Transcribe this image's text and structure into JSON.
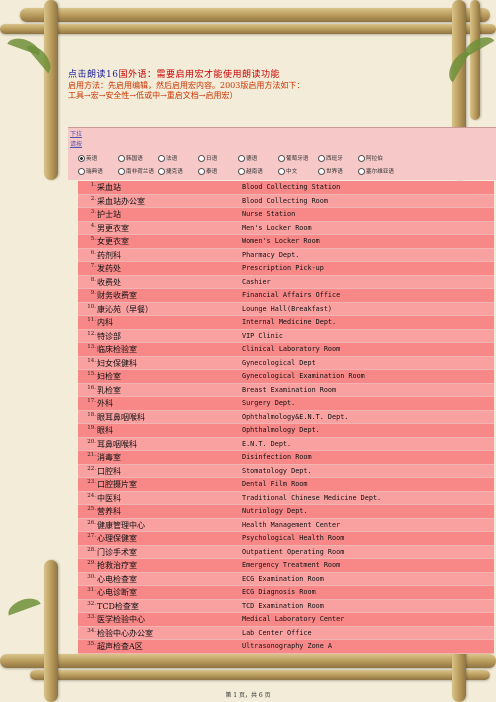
{
  "header": {
    "line1_prefix": "点击朗读",
    "line1_count": "16",
    "line1_suffix": "国外语：需要启用宏才能使用朗读功能",
    "line2": "启用方法：先启用编辑，然后启用宏内容。2003版启用方法如下：",
    "line3": "工具→宏→安全性→低或中→重启文档→启用宏）"
  },
  "panel": {
    "label1": "下拉",
    "label2": "请按",
    "row1": [
      {
        "label": "英语",
        "selected": true
      },
      {
        "label": "韩国语",
        "selected": false
      },
      {
        "label": "法语",
        "selected": false
      },
      {
        "label": "日语",
        "selected": false
      },
      {
        "label": "德语",
        "selected": false
      },
      {
        "label": "葡萄牙语",
        "selected": false
      },
      {
        "label": "西班牙",
        "selected": false
      },
      {
        "label": "阿拉伯",
        "selected": false
      }
    ],
    "row2": [
      {
        "label": "瑞典语",
        "selected": false
      },
      {
        "label": "南非荷兰语",
        "selected": false
      },
      {
        "label": "捷克语",
        "selected": false
      },
      {
        "label": "泰语",
        "selected": false
      },
      {
        "label": "越南语",
        "selected": false
      },
      {
        "label": "中文",
        "selected": false
      },
      {
        "label": "世界语",
        "selected": false
      },
      {
        "label": "塞尔维亚语",
        "selected": false
      }
    ]
  },
  "rows": [
    {
      "n": "1.",
      "cn": "采血站",
      "en": "Blood Collecting Station"
    },
    {
      "n": "2.",
      "cn": "采血站办公室",
      "en": "Blood Collecting Room"
    },
    {
      "n": "3.",
      "cn": "护士站",
      "en": "Nurse Station"
    },
    {
      "n": "4.",
      "cn": "男更衣室",
      "en": "Men's Locker Room"
    },
    {
      "n": "5.",
      "cn": "女更衣室",
      "en": "Women's Locker Room"
    },
    {
      "n": "6.",
      "cn": "药剂科",
      "en": "Pharmacy Dept."
    },
    {
      "n": "7.",
      "cn": "发药处",
      "en": "Prescription Pick-up"
    },
    {
      "n": "8.",
      "cn": "收费处",
      "en": "Cashier"
    },
    {
      "n": "9.",
      "cn": "财务收费室",
      "en": "Financial Affairs Office"
    },
    {
      "n": "10.",
      "cn": "康沁苑（早餐）",
      "en": "Lounge Hall(Breakfast)"
    },
    {
      "n": "11.",
      "cn": "内科",
      "en": "Internal Medicine Dept."
    },
    {
      "n": "12.",
      "cn": "特诊部",
      "en": "VIP Clinic"
    },
    {
      "n": "13.",
      "cn": "临床检验室",
      "en": "Clinical Laboratory Room"
    },
    {
      "n": "14.",
      "cn": "妇女保健科",
      "en": "Gynecological Dept"
    },
    {
      "n": "15.",
      "cn": "妇检室",
      "en": "Gynecological Examination Room"
    },
    {
      "n": "16.",
      "cn": "乳检室",
      "en": "Breast Examination Room"
    },
    {
      "n": "17.",
      "cn": "外科",
      "en": "Surgery Dept."
    },
    {
      "n": "18.",
      "cn": "眼耳鼻咽喉科",
      "en": "Ophthalmology&E.N.T. Dept."
    },
    {
      "n": "19.",
      "cn": "眼科",
      "en": "Ophthalmology Dept."
    },
    {
      "n": "20.",
      "cn": "耳鼻咽喉科",
      "en": "E.N.T. Dept."
    },
    {
      "n": "21.",
      "cn": "消毒室",
      "en": "Disinfection Room"
    },
    {
      "n": "22.",
      "cn": "口腔科",
      "en": "Stomatology Dept."
    },
    {
      "n": "23.",
      "cn": "口腔摄片室",
      "en": "Dental Film Room"
    },
    {
      "n": "24.",
      "cn": "中医科",
      "en": "Traditional Chinese Medicine Dept."
    },
    {
      "n": "25.",
      "cn": "营养科",
      "en": "Nutriology Dept."
    },
    {
      "n": "26.",
      "cn": "健康管理中心",
      "en": "Health Management Center"
    },
    {
      "n": "27.",
      "cn": "心理保健室",
      "en": "Psychological Health Room"
    },
    {
      "n": "28.",
      "cn": "门诊手术室",
      "en": "Outpatient Operating Room"
    },
    {
      "n": "29.",
      "cn": "抢救治疗室",
      "en": "Emergency Treatment Room"
    },
    {
      "n": "30.",
      "cn": "心电检查室",
      "en": "ECG Examination Room"
    },
    {
      "n": "31.",
      "cn": "心电诊断室",
      "en": "ECG Diagnosis Room"
    },
    {
      "n": "32.",
      "cn": "TCD检查室",
      "en": "TCD Examination Room"
    },
    {
      "n": "33.",
      "cn": "医学检验中心",
      "en": "Medical Laboratory Center"
    },
    {
      "n": "34.",
      "cn": "检验中心办公室",
      "en": "Lab Center Office"
    },
    {
      "n": "35.",
      "cn": "超声检查A区",
      "en": "Ultrasonography Zone A"
    }
  ],
  "footer": "第 1 页，共 6 页"
}
